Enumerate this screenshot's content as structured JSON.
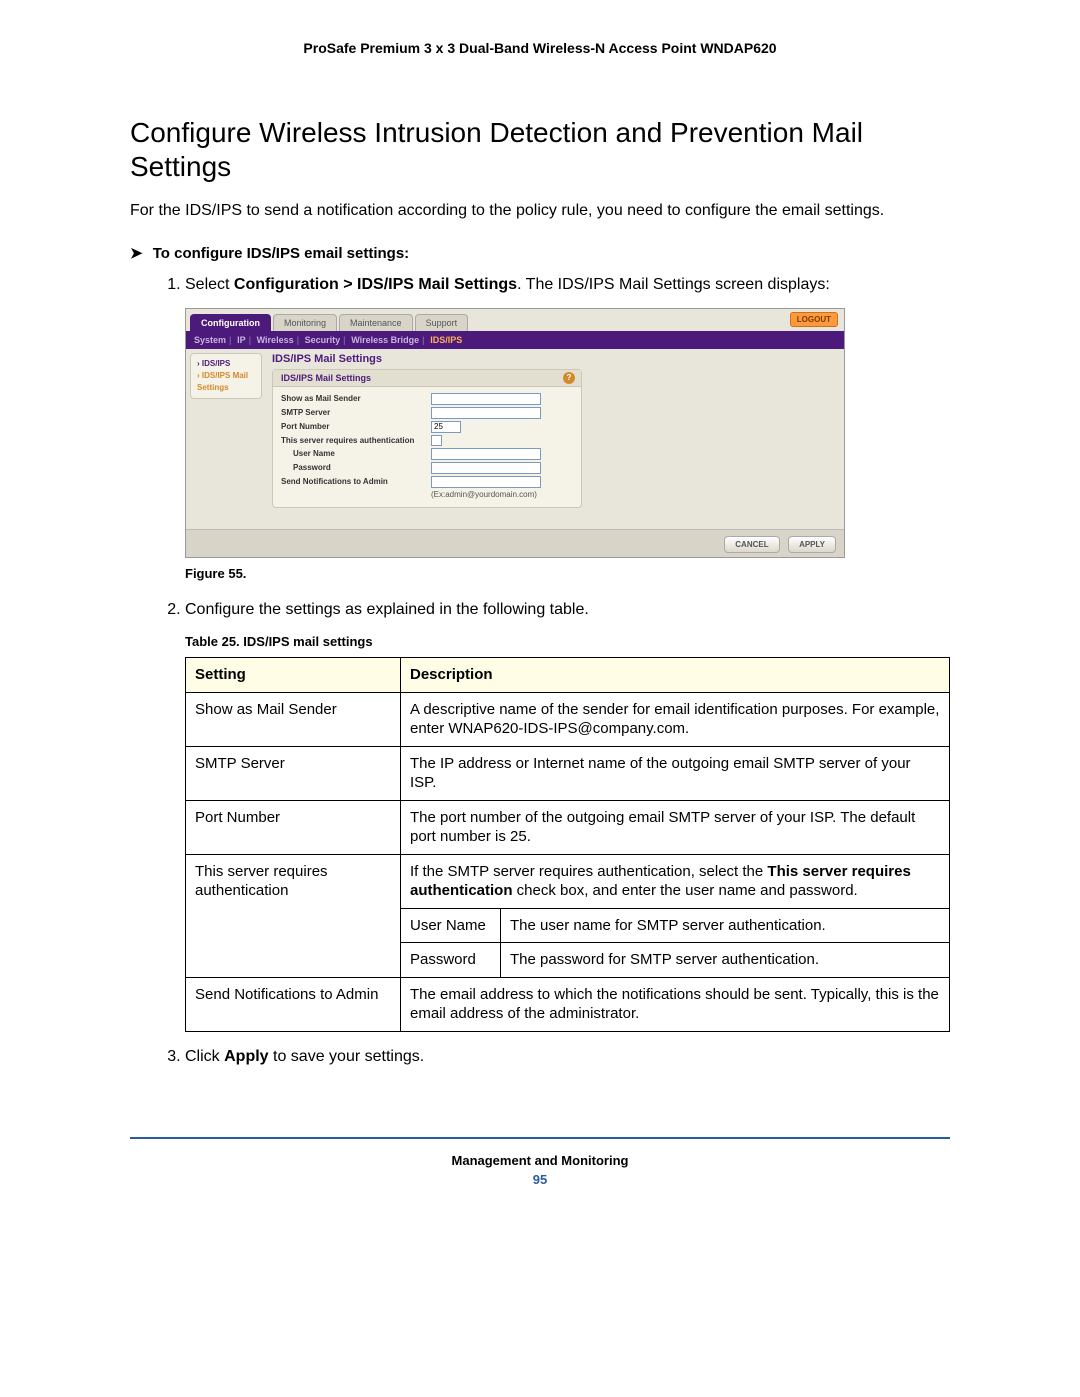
{
  "doc_header": "ProSafe Premium 3 x 3 Dual-Band Wireless-N Access Point WNDAP620",
  "section_title": "Configure Wireless Intrusion Detection and Prevention Mail Settings",
  "intro": "For the IDS/IPS to send a notification according to the policy rule, you need to configure the email settings.",
  "proc_arrow": "➤",
  "proc_heading": "To configure IDS/IPS email settings:",
  "steps": {
    "s1_num": "1.",
    "s1_a": "Select ",
    "s1_b": "Configuration > IDS/IPS Mail Settings",
    "s1_c": ". The IDS/IPS Mail Settings screen displays:",
    "s2_num": "2.",
    "s2": "Configure the settings as explained in the following table.",
    "s3_num": "3.",
    "s3_a": "Click ",
    "s3_b": "Apply",
    "s3_c": " to save your settings."
  },
  "screenshot": {
    "tabs": [
      "Configuration",
      "Monitoring",
      "Maintenance",
      "Support"
    ],
    "logout": "LOGOUT",
    "subnav": [
      "System",
      "IP",
      "Wireless",
      "Security",
      "Wireless Bridge",
      "IDS/IPS"
    ],
    "side": {
      "item1": "IDS/IPS",
      "item2": "IDS/IPS Mail Settings"
    },
    "main_title": "IDS/IPS Mail Settings",
    "panel_title": "IDS/IPS Mail Settings",
    "fields": {
      "sender": "Show as Mail Sender",
      "smtp": "SMTP Server",
      "port": "Port Number",
      "port_value": "25",
      "auth": "This server requires authentication",
      "user": "User Name",
      "pass": "Password",
      "notif": "Send Notifications to Admin",
      "hint": "(Ex:admin@yourdomain.com)"
    },
    "buttons": {
      "cancel": "CANCEL",
      "apply": "APPLY"
    }
  },
  "figure_caption": "Figure 55.",
  "table_caption": "Table 25.  IDS/IPS mail settings",
  "table": {
    "h1": "Setting",
    "h2": "Description",
    "rows": [
      {
        "setting": "Show as Mail Sender",
        "desc": "A descriptive name of the sender for email identification purposes. For example, enter WNAP620-IDS-IPS@company.com."
      },
      {
        "setting": "SMTP Server",
        "desc": "The IP address or Internet name of the outgoing email SMTP server of your ISP."
      },
      {
        "setting": "Port Number",
        "desc": "The port number of the outgoing email SMTP server of your ISP. The default port number is 25."
      }
    ],
    "auth_row": {
      "setting": "This server requires authentication",
      "desc_a": "If the SMTP server requires authentication, select the ",
      "desc_b": "This server requires authentication",
      "desc_c": " check box, and enter the user name and password."
    },
    "sub_rows": [
      {
        "sub": "User Name",
        "desc": "The user name for SMTP server authentication."
      },
      {
        "sub": "Password",
        "desc": "The password for SMTP server authentication."
      }
    ],
    "last_row": {
      "setting": "Send Notifications to Admin",
      "desc": "The email address to which the notifications should be sent. Typically, this is the email address of the administrator."
    }
  },
  "footer": {
    "chapter": "Management and Monitoring",
    "page": "95"
  }
}
